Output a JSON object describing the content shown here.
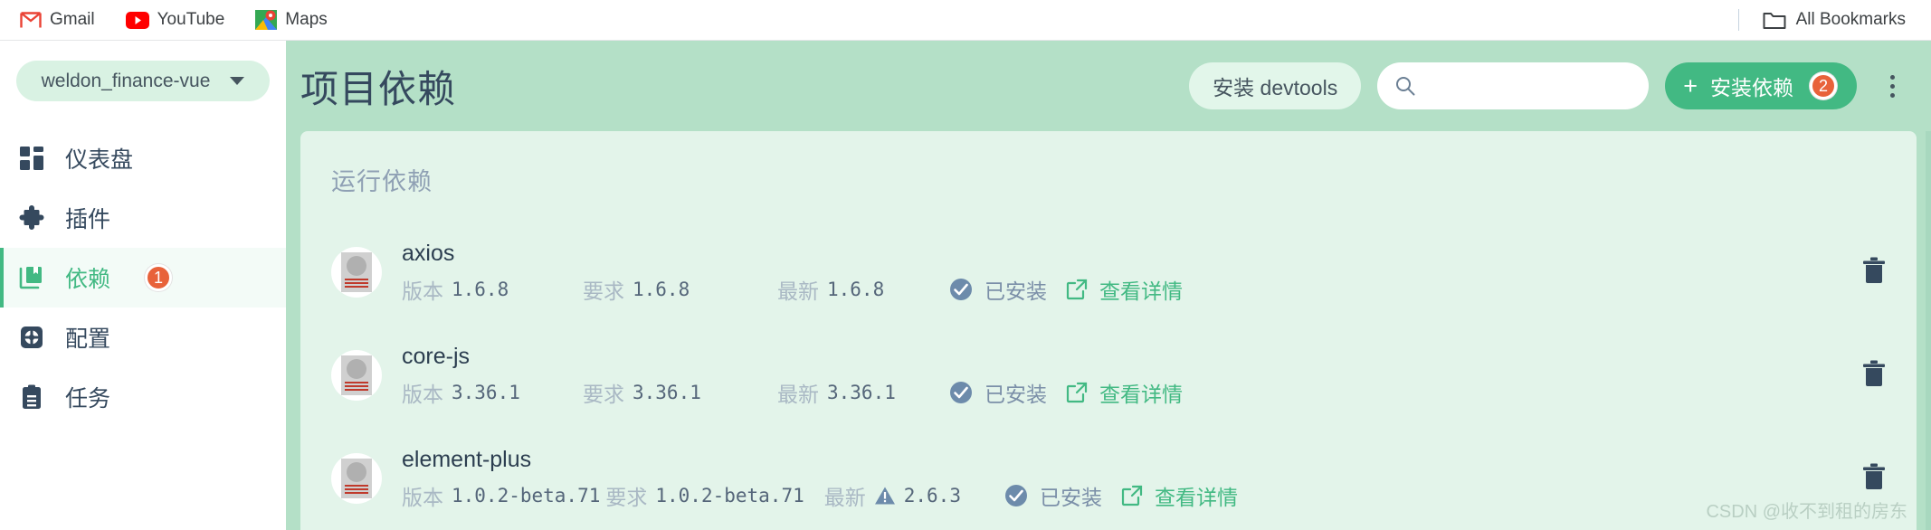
{
  "browser": {
    "bookmarks": [
      {
        "label": "Gmail",
        "icon": "gmail-icon"
      },
      {
        "label": "YouTube",
        "icon": "youtube-icon"
      },
      {
        "label": "Maps",
        "icon": "maps-icon"
      }
    ],
    "all_bookmarks_label": "All Bookmarks",
    "all_bookmarks_icon": "folder-icon"
  },
  "sidebar": {
    "project_selector": {
      "value": "weldon_finance-vue",
      "icon": "chevron-down-icon"
    },
    "items": [
      {
        "label": "仪表盘",
        "icon": "dashboard-icon",
        "active": false,
        "badge": ""
      },
      {
        "label": "插件",
        "icon": "puzzle-icon",
        "active": false,
        "badge": ""
      },
      {
        "label": "依赖",
        "icon": "books-icon",
        "active": true,
        "badge": "1"
      },
      {
        "label": "配置",
        "icon": "gear-icon",
        "active": false,
        "badge": ""
      },
      {
        "label": "任务",
        "icon": "clipboard-icon",
        "active": false,
        "badge": ""
      }
    ]
  },
  "header": {
    "title": "项目依赖",
    "devtools_button": "安装 devtools",
    "search": {
      "value": "",
      "placeholder": "",
      "icon": "search-icon"
    },
    "install_button": {
      "label": "安装依赖",
      "plus": "+",
      "badge": "2"
    },
    "more_icon": "kebab-menu-icon"
  },
  "panel": {
    "section_title": "运行依赖",
    "labels": {
      "version": "版本",
      "required": "要求",
      "latest": "最新",
      "installed": "已安装",
      "details": "查看详情"
    },
    "icons": {
      "installed": "check-circle-icon",
      "details": "external-link-icon",
      "warning": "warning-triangle-icon",
      "delete": "trash-icon",
      "avatar": "broken-image-avatar"
    },
    "dependencies": [
      {
        "name": "axios",
        "version": "1.6.8",
        "required": "1.6.8",
        "latest": "1.6.8",
        "latest_warning": false,
        "status": "已安装",
        "details": "查看详情"
      },
      {
        "name": "core-js",
        "version": "3.36.1",
        "required": "3.36.1",
        "latest": "3.36.1",
        "latest_warning": false,
        "status": "已安装",
        "details": "查看详情"
      },
      {
        "name": "element-plus",
        "version": "1.0.2-beta.71",
        "required": "1.0.2-beta.71",
        "latest": "2.6.3",
        "latest_warning": true,
        "status": "已安装",
        "details": "查看详情"
      }
    ]
  },
  "watermark": "CSDN @收不到租的房东",
  "colors": {
    "brand_green": "#42b983",
    "header_green": "#b4e0c7",
    "panel_green": "#e3f4ea",
    "badge_orange": "#e8623a",
    "text_dark": "#35495e",
    "text_muted": "#a9b8c4"
  }
}
